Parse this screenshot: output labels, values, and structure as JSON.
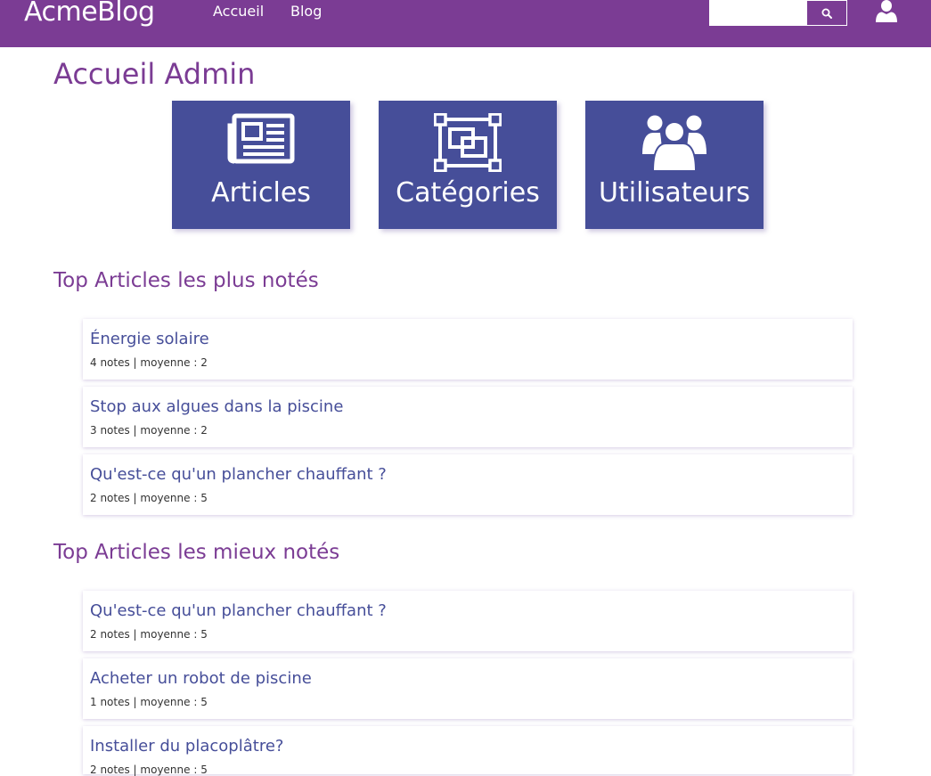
{
  "navbar": {
    "brand": "AcmeBlog",
    "links": [
      {
        "label": "Accueil"
      },
      {
        "label": "Blog"
      }
    ],
    "search": {
      "value": "",
      "placeholder": ""
    },
    "icons": {
      "search": "search-icon",
      "user": "user-icon"
    },
    "color": "#7b3c94"
  },
  "page": {
    "title": "Accueil Admin"
  },
  "tiles": [
    {
      "label": "Articles",
      "icon": "newspaper-icon"
    },
    {
      "label": "Catégories",
      "icon": "object-group-icon"
    },
    {
      "label": "Utilisateurs",
      "icon": "users-icon"
    }
  ],
  "sections": [
    {
      "title": "Top Articles les plus notés",
      "articles": [
        {
          "title": "Énergie solaire",
          "meta": "4 notes | moyenne : 2"
        },
        {
          "title": "Stop aux algues dans la piscine",
          "meta": "3 notes | moyenne : 2"
        },
        {
          "title": "Qu'est-ce qu'un plancher chauffant ?",
          "meta": "2 notes | moyenne : 5"
        }
      ]
    },
    {
      "title": "Top Articles les mieux notés",
      "articles": [
        {
          "title": "Qu'est-ce qu'un plancher chauffant ?",
          "meta": "2 notes | moyenne : 5"
        },
        {
          "title": "Acheter un robot de piscine",
          "meta": "1 notes | moyenne : 5"
        },
        {
          "title": "Installer du placoplâtre?",
          "meta": "2 notes | moyenne : 5"
        }
      ]
    }
  ],
  "colors": {
    "primary": "#7b3c94",
    "tile": "#464e99",
    "link": "#464e99"
  }
}
